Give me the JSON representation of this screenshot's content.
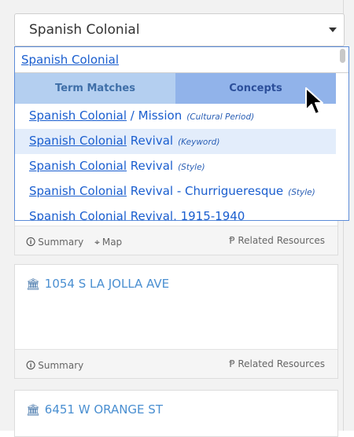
{
  "select": {
    "value": "Spanish Colonial"
  },
  "dropdown": {
    "search_text": "Spanish Colonial",
    "tabs": [
      {
        "label": "Term Matches"
      },
      {
        "label": "Concepts"
      }
    ],
    "results": [
      {
        "term": "Spanish Colonial",
        "rest": " / Mission",
        "type": "(Cultural Period)"
      },
      {
        "term": "Spanish Colonial",
        "rest": " Revival",
        "type": "(Keyword)"
      },
      {
        "term": "Spanish Colonial",
        "rest": " Revival",
        "type": "(Style)"
      },
      {
        "term": "Spanish Colonial",
        "rest": " Revival - Churrigueresque",
        "type": "(Style)"
      },
      {
        "term": "Spanish Colonial",
        "rest": " Revival, 1915-1940",
        "type": ""
      }
    ]
  },
  "cards": [
    {
      "title": "",
      "footer_summary": "Summary",
      "footer_map": "Map",
      "footer_related": "Related Resources"
    },
    {
      "title": "1054 S LA JOLLA AVE",
      "footer_summary": "Summary",
      "footer_related": "Related Resources"
    },
    {
      "title": "6451 W ORANGE ST"
    }
  ]
}
